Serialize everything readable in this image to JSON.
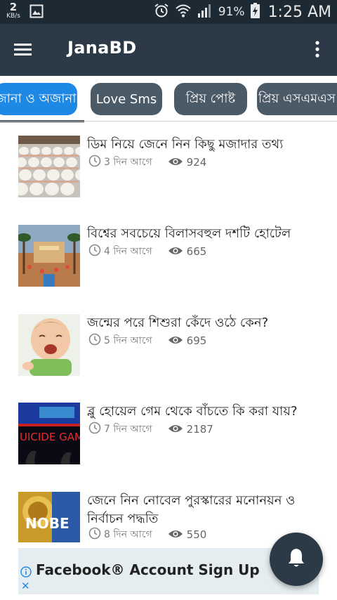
{
  "status_bar": {
    "net_speed_value": "2",
    "net_speed_unit": "KB/s",
    "battery_percent": "91%",
    "time": "1:25 AM",
    "icons": [
      "gallery-icon",
      "alarm-icon",
      "wifi-icon",
      "signal-icon",
      "battery-charging-icon"
    ]
  },
  "app_bar": {
    "title": "JanaBD",
    "menu_icon": "hamburger-menu-icon",
    "more_icon": "more-vert-icon"
  },
  "tabs": [
    {
      "label": "জানা ও অজানা",
      "active": true
    },
    {
      "label": "Love Sms",
      "active": false
    },
    {
      "label": "প্রিয় পোষ্ট",
      "active": false
    },
    {
      "label": "প্রিয় এসএমএস",
      "active": false
    }
  ],
  "posts": [
    {
      "title": "ডিম নিয়ে জেনে নিন কিছু মজাদার তথ্য",
      "time": "3 দিন আগে",
      "views": "924"
    },
    {
      "title": "বিশ্বের সবচেয়ে বিলাসবহুল দশটি হোটেল",
      "time": "4 দিন আগে",
      "views": "665"
    },
    {
      "title": "জন্মের পরে শিশুরা কেঁদে ওঠে কেন?",
      "time": "5 দিন আগে",
      "views": "695"
    },
    {
      "title": "ব্লু হোয়েল গেম থেকে বাঁচতে কি করা যায়?",
      "time": "7 দিন আগে",
      "views": "2187",
      "thumb_text": "UICIDE GAM"
    },
    {
      "title": "জেনে নিন নোবেল পুরস্কারের মনোনয়ন ও নির্বাচন পদ্ধতি",
      "time": "8 দিন আগে",
      "views": "550",
      "thumb_text": "NOBE"
    }
  ],
  "ad": {
    "text": "Facebook® Account Sign Up",
    "close_label": "✕"
  },
  "fab": {
    "icon": "notification-bell-icon"
  },
  "colors": {
    "status_bar": "#1e2a33",
    "app_bar": "#2b3a46",
    "active_tab": "#1e88e5",
    "inactive_tab": "#4a5a67"
  }
}
